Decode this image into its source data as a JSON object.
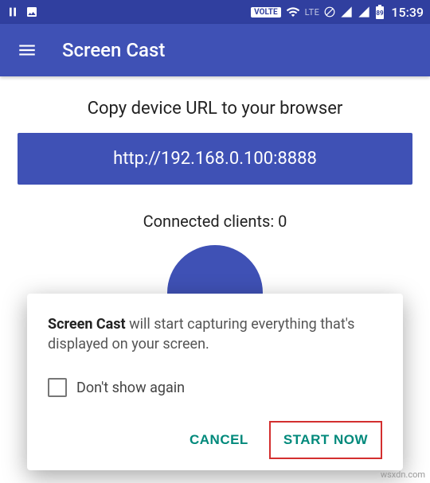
{
  "statusbar": {
    "volte": "VOLTE",
    "lte": "LTE",
    "battery": "89",
    "time": "15:39"
  },
  "appbar": {
    "title": "Screen Cast"
  },
  "main": {
    "instruction": "Copy device URL to your browser",
    "url": "http://192.168.0.100:8888",
    "clients_label": "Connected clients: ",
    "clients_count": "0"
  },
  "dialog": {
    "bold": "Screen Cast",
    "message": " will start capturing everything that's displayed on your screen.",
    "dont_show": "Don't show again",
    "cancel": "CANCEL",
    "start": "START NOW"
  },
  "watermark": "wsxdn.com"
}
